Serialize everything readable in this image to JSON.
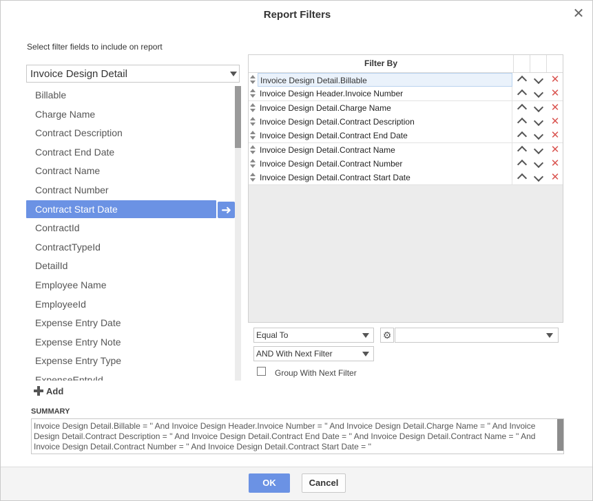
{
  "dialog": {
    "title": "Report Filters",
    "close_icon": "close-icon"
  },
  "left": {
    "instruction": "Select filter fields to include on report",
    "table_select": "Invoice Design Detail",
    "fields": [
      "Billable",
      "Charge Name",
      "Contract Description",
      "Contract End Date",
      "Contract Name",
      "Contract Number",
      "Contract Start Date",
      "ContractId",
      "ContractTypeId",
      "DetailId",
      "Employee Name",
      "EmployeeId",
      "Expense Entry Date",
      "Expense Entry Note",
      "Expense Entry Type",
      "ExpenseEntryId"
    ],
    "selected_field": "Contract Start Date",
    "add_label": "Add"
  },
  "filters": {
    "header": "Filter By",
    "rows": [
      "Invoice Design Detail.Billable",
      "Invoice Design Header.Invoice Number",
      "Invoice Design Detail.Charge Name",
      "Invoice Design Detail.Contract Description",
      "Invoice Design Detail.Contract End Date",
      "Invoice Design Detail.Contract Name",
      "Invoice Design Detail.Contract Number",
      "Invoice Design Detail.Contract Start Date"
    ],
    "operator": "Equal To",
    "value": "",
    "conjunction": "AND With Next Filter",
    "group_label": "Group With Next Filter",
    "group_checked": false
  },
  "summary": {
    "label": "SUMMARY",
    "text": "Invoice Design Detail.Billable = '' And Invoice Design Header.Invoice Number = '' And Invoice Design Detail.Charge Name = '' And Invoice Design Detail.Contract Description = '' And Invoice Design Detail.Contract End Date = '' And Invoice Design Detail.Contract Name = '' And Invoice Design Detail.Contract Number = '' And Invoice Design Detail.Contract Start Date = ''"
  },
  "footer": {
    "ok_label": "OK",
    "cancel_label": "Cancel"
  },
  "colors": {
    "accent": "#6b92e4",
    "delete": "#d9534f"
  }
}
